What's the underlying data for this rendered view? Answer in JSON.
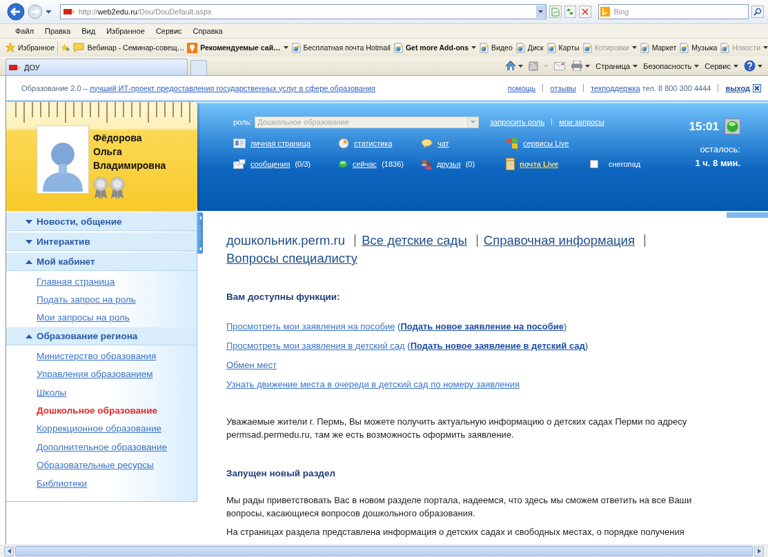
{
  "browser": {
    "address": {
      "prefix": "http://",
      "host": "web2edu.ru",
      "path": "/Dou/DouDefault.aspx"
    },
    "search": {
      "placeholder": "Bing"
    },
    "menu": [
      "Файл",
      "Правка",
      "Вид",
      "Избранное",
      "Сервис",
      "Справка"
    ],
    "favorites_button": "Избранное",
    "favorites": [
      {
        "label": "Вебинар - Семинар-совещ…",
        "kind": "message",
        "bold": false,
        "dropdown": false,
        "disabled": false
      },
      {
        "label": "Рекомендуемые сай…",
        "kind": "suggested",
        "bold": true,
        "dropdown": true,
        "disabled": false
      },
      {
        "label": "Бесплатная почта Hotmail",
        "kind": "page",
        "bold": false,
        "dropdown": false,
        "disabled": false
      },
      {
        "label": "Get more Add-ons",
        "kind": "page",
        "bold": true,
        "dropdown": true,
        "disabled": false
      },
      {
        "label": "Видео",
        "kind": "page",
        "bold": false,
        "dropdown": false,
        "disabled": false
      },
      {
        "label": "Диск",
        "kind": "page",
        "bold": false,
        "dropdown": false,
        "disabled": false
      },
      {
        "label": "Карты",
        "kind": "page",
        "bold": false,
        "dropdown": false,
        "disabled": false
      },
      {
        "label": "Котировки",
        "kind": "page",
        "bold": false,
        "dropdown": true,
        "disabled": true
      },
      {
        "label": "Маркет",
        "kind": "page",
        "bold": false,
        "dropdown": false,
        "disabled": false
      },
      {
        "label": "Музыка",
        "kind": "page",
        "bold": false,
        "dropdown": false,
        "disabled": false
      },
      {
        "label": "Новости",
        "kind": "page",
        "bold": false,
        "dropdown": true,
        "disabled": true
      }
    ],
    "tab": {
      "title": "ДОУ"
    },
    "commands": [
      "Страница",
      "Безопасность",
      "Сервис"
    ]
  },
  "top_bar": {
    "tagline": "Образование 2.0 –",
    "tagline_link": "лучший ИТ-проект предоставления государственных услуг в сфере образования",
    "links": [
      "помощь",
      "отзывы",
      "техподдержка"
    ],
    "phone": "тел. 8 800 300 4444",
    "logout": "выход"
  },
  "profile": {
    "name": [
      "Фёдорова",
      "Ольга",
      "Владимировна"
    ]
  },
  "panel": {
    "role_label": "роль:",
    "role_value": "Дошкольное образование",
    "role_links": [
      "запросить роль",
      "мои запросы"
    ],
    "links": [
      {
        "kind": "card",
        "label": "личная страница",
        "highlight": false
      },
      {
        "kind": "clock",
        "label": "статистика",
        "highlight": false
      },
      {
        "kind": "chat",
        "label": "чат",
        "highlight": false
      },
      {
        "kind": "windows",
        "label": "сервисы Live",
        "highlight": false
      },
      {
        "kind": "mail",
        "label": "сообщения",
        "count": "(0/3)",
        "highlight": false
      },
      {
        "kind": "dot",
        "label": "сейчас",
        "count": "(1836)",
        "highlight": false
      },
      {
        "kind": "friends",
        "label": "друзья",
        "count": "(0)",
        "highlight": false
      },
      {
        "kind": "package",
        "label": "почта Live",
        "highlight": true
      }
    ],
    "snowfall": {
      "label": "снегопад",
      "checked": false
    },
    "time": "15:01",
    "remaining_label": "осталось:",
    "remaining": "1 ч. 8 мин."
  },
  "sidebar": {
    "sections": [
      {
        "title": "Новости, общение",
        "expanded": false
      },
      {
        "title": "Интерактив",
        "expanded": false
      },
      {
        "title": "Мой кабинет",
        "expanded": true,
        "items": [
          {
            "label": "Главная страница",
            "selected": false
          },
          {
            "label": "Подать запрос на роль",
            "selected": false
          },
          {
            "label": "Мои запросы на роль",
            "selected": false
          }
        ]
      },
      {
        "title": "Образование региона",
        "expanded": true,
        "items": [
          {
            "label": "Министерство образования",
            "selected": false
          },
          {
            "label": "Управления образованием",
            "selected": false
          },
          {
            "label": "Школы",
            "selected": false
          },
          {
            "label": "Дошкольное образование",
            "selected": true
          },
          {
            "label": "Коррекционное образование",
            "selected": false
          },
          {
            "label": "Дополнительное образование",
            "selected": false
          },
          {
            "label": "Образовательные ресурсы",
            "selected": false
          },
          {
            "label": "Библиотеки",
            "selected": false
          }
        ]
      }
    ]
  },
  "content": {
    "breadcrumb": [
      {
        "label": "дошкольник.perm.ru",
        "current": true
      },
      {
        "label": "Все детские сады",
        "current": false
      },
      {
        "label": "Справочная информация",
        "current": false
      },
      {
        "label": "Вопросы специалисту",
        "current": false
      }
    ],
    "functions_heading": "Вам доступны функции:",
    "functions": [
      {
        "link": "Просмотреть мои заявления на пособие",
        "open": "(",
        "extra": "Подать новое заявление на пособие",
        "close": ")"
      },
      {
        "link": "Просмотреть мои заявления в детский сад",
        "open": "(",
        "extra": "Подать новое заявление в детский сад",
        "close": ")"
      },
      {
        "link": "Обмен мест"
      },
      {
        "link": "Узнать движение места в очереди в детский сад по номеру заявления"
      }
    ],
    "notice": "Уважаемые жители г. Пермь, Вы можете получить актуальную информацию о детских садах Перми по адресу permsad.permedu.ru, там же есть возможность оформить заявление.",
    "section_heading": "Запущен новый раздел",
    "paragraphs": [
      "Мы рады приветствовать Вас в новом разделе портала, надеемся, что здесь мы сможем ответить на все Ваши вопросы, касающиеся вопросов дошкольного образования.",
      "На страницах раздела представлена информация о детских садах и свободных местах, о порядке получения"
    ]
  }
}
